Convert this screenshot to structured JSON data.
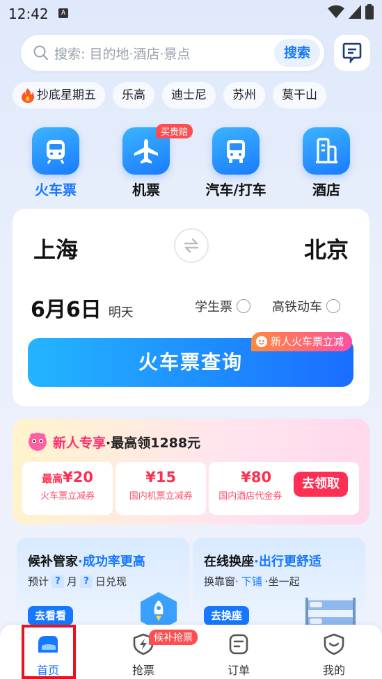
{
  "status": {
    "time": "12:42",
    "notif_letter": "A"
  },
  "search": {
    "placeholder": "搜索: 目的地·酒店·景点",
    "button_label": "搜索"
  },
  "chips": [
    {
      "label": "抄底星期五",
      "icon": "fire-icon"
    },
    {
      "label": "乐高"
    },
    {
      "label": "迪士尼"
    },
    {
      "label": "苏州"
    },
    {
      "label": "莫干山"
    }
  ],
  "categories": [
    {
      "label": "火车票",
      "icon": "train-icon",
      "active": true
    },
    {
      "label": "机票",
      "icon": "plane-icon",
      "badge": "买贵赔"
    },
    {
      "label": "汽车/打车",
      "icon": "bus-icon"
    },
    {
      "label": "酒店",
      "icon": "hotel-icon"
    }
  ],
  "booking": {
    "from_city": "上海",
    "to_city": "北京",
    "date": "6月6日",
    "date_sub": "明天",
    "option_student": "学生票",
    "option_highspeed": "高铁动车",
    "query_button": "火车票查询",
    "promo_tag": "新人火车票立减"
  },
  "newbie": {
    "title_pink": "新人专享",
    "title_rest": "·最高领1288元",
    "coupons": [
      {
        "prefix": "最高",
        "amount": "¥20",
        "desc": "火车票立减券"
      },
      {
        "prefix": "",
        "amount": "¥15",
        "desc": "国内机票立减券"
      },
      {
        "prefix": "",
        "amount": "¥80",
        "desc": "国内酒店代金券"
      }
    ],
    "claim_button": "去领取"
  },
  "features": [
    {
      "title": "候补管家",
      "highlight": "·成功率更高",
      "sub_prefix": "预计",
      "q1": "?",
      "sub_mid": "月",
      "q2": "?",
      "sub_suffix": "日兑现",
      "button": "去看看"
    },
    {
      "title": "在线换座",
      "highlight": "·出行更舒适",
      "sub": "换靠窗·",
      "sub_blue": "下铺",
      "sub_end": "·坐一起",
      "button": "去换座"
    }
  ],
  "nav": [
    {
      "label": "首页",
      "icon": "home-icon",
      "active": true
    },
    {
      "label": "抢票",
      "icon": "lightning-shield-icon",
      "badge": "候补抢票"
    },
    {
      "label": "订单",
      "icon": "order-icon"
    },
    {
      "label": "我的",
      "icon": "profile-icon"
    }
  ],
  "colors": {
    "accent": "#1677ff",
    "badge_red": "#ff4d4f",
    "highlight_red": "#e6141f"
  }
}
